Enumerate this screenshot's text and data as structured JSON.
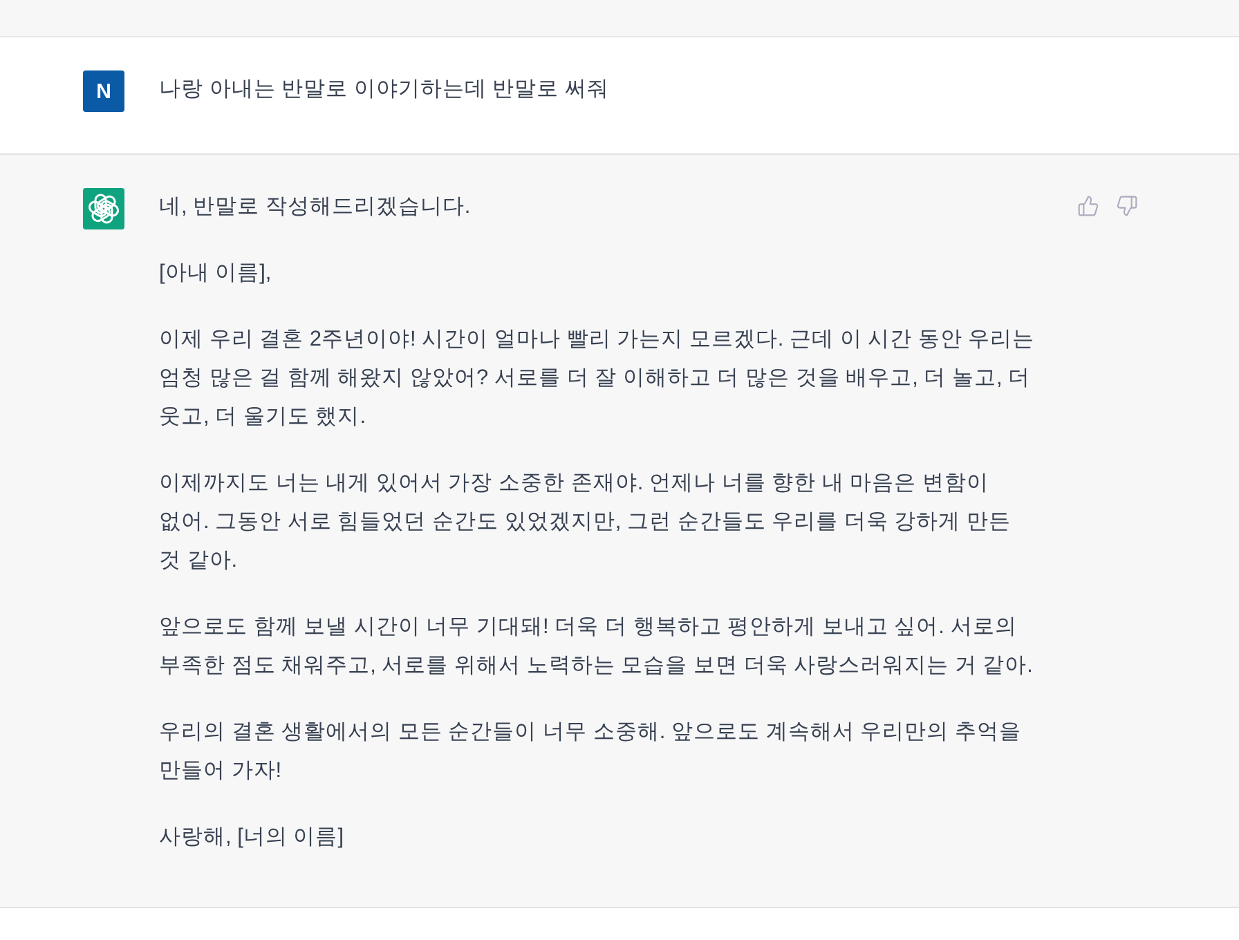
{
  "messages": [
    {
      "kind": "user",
      "avatar": "N",
      "paragraphs": [
        "나랑 아내는 반말로 이야기하는데 반말로 써줘"
      ]
    },
    {
      "kind": "assistant",
      "paragraphs": [
        "네, 반말로 작성해드리겠습니다.",
        "[아내 이름],",
        "이제 우리 결혼 2주년이야! 시간이 얼마나 빨리 가는지 모르겠다. 근데 이 시간 동안 우리는 엄청 많은 걸 함께 해왔지 않았어? 서로를 더 잘 이해하고 더 많은 것을 배우고, 더 놀고, 더 웃고, 더 울기도 했지.",
        "이제까지도 너는 내게 있어서 가장 소중한 존재야. 언제나 너를 향한 내 마음은 변함이 없어. 그동안 서로 힘들었던 순간도 있었겠지만, 그런 순간들도 우리를 더욱 강하게 만든 것 같아.",
        "앞으로도 함께 보낼 시간이 너무 기대돼! 더욱 더 행복하고 평안하게 보내고 싶어. 서로의 부족한 점도 채워주고, 서로를 위해서 노력하는 모습을 보면 더욱 사랑스러워지는 거 같아.",
        "우리의 결혼 생활에서의 모든 순간들이 너무 소중해. 앞으로도 계속해서 우리만의 추억을 만들어 가자!",
        "사랑해, [너의 이름]"
      ],
      "actions": [
        {
          "kind": "thumbs-up"
        },
        {
          "kind": "thumbs-down"
        }
      ]
    }
  ]
}
